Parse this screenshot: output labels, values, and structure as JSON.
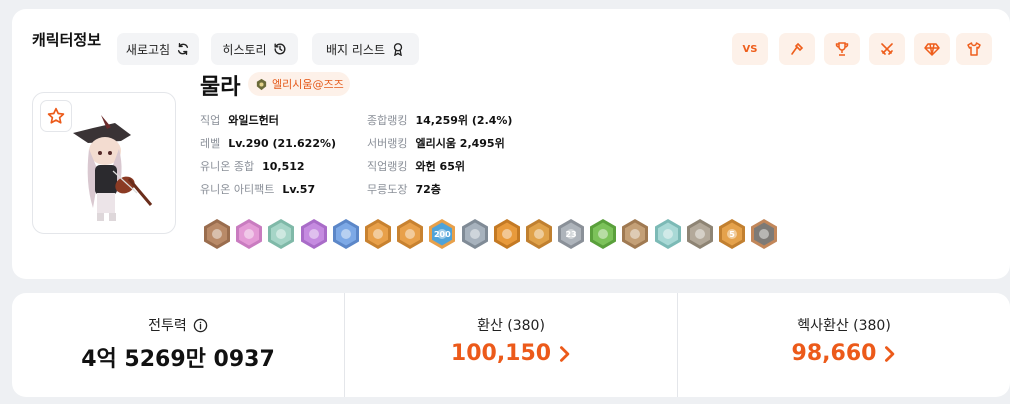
{
  "header": {
    "title": "캐릭터정보",
    "refresh_label": "새로고침",
    "history_label": "히스토리",
    "badge_list_label": "배지 리스트",
    "vs_label": "VS"
  },
  "character": {
    "name": "물라",
    "guild": "엘리시움@즈즈"
  },
  "info_left": [
    {
      "label": "직업",
      "value": "와일드헌터"
    },
    {
      "label": "레벨",
      "value": "Lv.290 (21.622%)"
    },
    {
      "label": "유니온 종합",
      "value": "10,512"
    },
    {
      "label": "유니온 아티팩트",
      "value": "Lv.57"
    }
  ],
  "info_right": [
    {
      "label": "종합랭킹",
      "value": "14,259위 (2.4%)"
    },
    {
      "label": "서버랭킹",
      "value": "엘리시움 2,495위"
    },
    {
      "label": "직업랭킹",
      "value": "와헌 65위"
    },
    {
      "label": "무릉도장",
      "value": "72층"
    }
  ],
  "badges": [
    {
      "fill": "#b98a68",
      "ring": "#9a6d4e",
      "label": ""
    },
    {
      "fill": "#e49bd6",
      "ring": "#c97cc0",
      "label": ""
    },
    {
      "fill": "#a6d5c7",
      "ring": "#7fb9a8",
      "label": ""
    },
    {
      "fill": "#c58be0",
      "ring": "#a96cc8",
      "label": ""
    },
    {
      "fill": "#7da9e6",
      "ring": "#5c87c8",
      "label": ""
    },
    {
      "fill": "#e8a04a",
      "ring": "#c88230",
      "label": ""
    },
    {
      "fill": "#e8a04a",
      "ring": "#c88230",
      "label": ""
    },
    {
      "fill": "#4fa3d9",
      "ring": "#e8a04a",
      "label": "200"
    },
    {
      "fill": "#a7b2bd",
      "ring": "#808b96",
      "label": ""
    },
    {
      "fill": "#e89a3c",
      "ring": "#c47a24",
      "label": ""
    },
    {
      "fill": "#e0a24a",
      "ring": "#c08030",
      "label": ""
    },
    {
      "fill": "#aeb4bb",
      "ring": "#8a9098",
      "label": "23"
    },
    {
      "fill": "#7cc25a",
      "ring": "#5aa03c",
      "label": ""
    },
    {
      "fill": "#c4a077",
      "ring": "#a07a52",
      "label": ""
    },
    {
      "fill": "#a9d9d6",
      "ring": "#7cbab6",
      "label": ""
    },
    {
      "fill": "#b3a99a",
      "ring": "#8e8474",
      "label": ""
    },
    {
      "fill": "#e5a24c",
      "ring": "#c28030",
      "label": "5"
    },
    {
      "fill": "#7d7a76",
      "ring": "#c2875a",
      "label": ""
    }
  ],
  "stats": {
    "combat_power_label": "전투력",
    "combat_power_value": "4억 5269만 0937",
    "rebirth_label": "환산 (380)",
    "rebirth_value": "100,150",
    "hexa_label": "헥사환산 (380)",
    "hexa_value": "98,660"
  },
  "icons": {
    "refresh": "refresh-icon",
    "history": "history-icon",
    "badge": "badge-icon",
    "hammer": "hammer-icon",
    "trophy": "trophy-icon",
    "swords": "crossed-swords-icon",
    "gem": "gem-icon",
    "shirt": "shirt-icon",
    "star": "star-icon",
    "info": "info-icon",
    "chevron": "chevron-right-icon"
  },
  "colors": {
    "accent": "#ec5a1a",
    "accent_bg": "#fdf1e9"
  }
}
